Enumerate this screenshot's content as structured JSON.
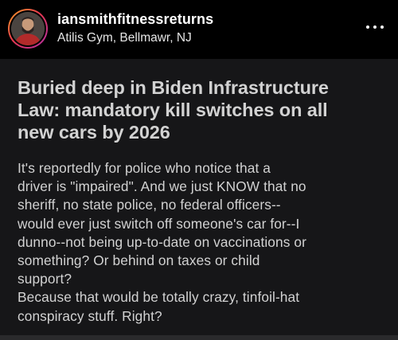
{
  "header": {
    "username": "iansmithfitnessreturns",
    "location": "Atilis Gym, Bellmawr, NJ",
    "more_icon": "more-horizontal-icon"
  },
  "post": {
    "title_lines": [
      "Buried deep in Biden Infrastructure",
      "Law: mandatory kill switches on all",
      "new cars by 2026"
    ],
    "body_lines": [
      "It's reportedly for police who notice that a",
      "driver is \"impaired\".  And we just KNOW that no",
      "sheriff, no state police, no federal officers--",
      "would ever just switch off someone's car for--I",
      "dunno--not being up-to-date on vaccinations or",
      "something?  Or behind on taxes or child",
      "support?",
      "Because that would be totally crazy, tinfoil-hat",
      "conspiracy stuff.  Right?"
    ]
  },
  "colors": {
    "background": "#000000",
    "post_background": "#161618",
    "post_text": "#d2d2d2",
    "username": "#ffffff",
    "avatar_ring": "#e8384f"
  }
}
